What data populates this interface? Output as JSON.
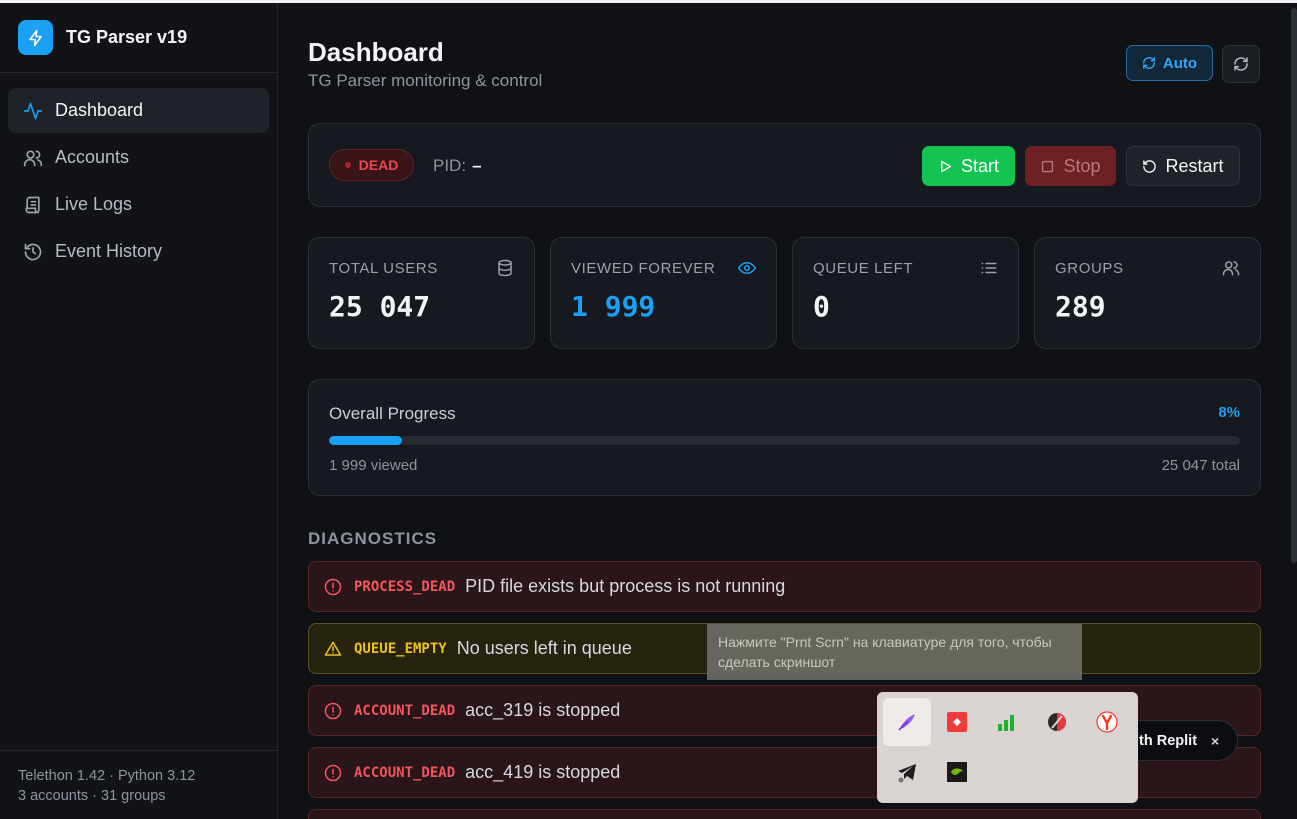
{
  "app": {
    "title": "TG Parser v19"
  },
  "sidebar": {
    "items": [
      {
        "label": "Dashboard",
        "icon": "activity-icon",
        "active": true
      },
      {
        "label": "Accounts",
        "icon": "users-icon"
      },
      {
        "label": "Live Logs",
        "icon": "scroll-icon"
      },
      {
        "label": "Event History",
        "icon": "history-icon"
      }
    ],
    "footer": {
      "line1": "Telethon 1.42 · Python 3.12",
      "line2": "3 accounts · 31 groups"
    }
  },
  "header": {
    "title": "Dashboard",
    "subtitle": "TG Parser monitoring & control",
    "auto_label": "Auto"
  },
  "process": {
    "status": "DEAD",
    "pid_label": "PID:",
    "pid_value": "–",
    "start_label": "Start",
    "stop_label": "Stop",
    "restart_label": "Restart"
  },
  "stats": [
    {
      "label": "TOTAL USERS",
      "value": "25 047",
      "icon": "database-icon"
    },
    {
      "label": "VIEWED FOREVER",
      "value": "1 999",
      "icon": "eye-icon",
      "color": "#1aa0f5"
    },
    {
      "label": "QUEUE LEFT",
      "value": "0",
      "icon": "list-icon"
    },
    {
      "label": "GROUPS",
      "value": "289",
      "icon": "users-icon"
    }
  ],
  "progress": {
    "label": "Overall Progress",
    "percent_text": "8%",
    "fraction": 0.08,
    "viewed_text": "1 999 viewed",
    "total_text": "25 047 total"
  },
  "diagnostics": {
    "title": "DIAGNOSTICS",
    "items": [
      {
        "level": "error",
        "code": "PROCESS_DEAD",
        "message": "PID file exists but process is not running"
      },
      {
        "level": "warning",
        "code": "QUEUE_EMPTY",
        "message": "No users left in queue"
      },
      {
        "level": "error",
        "code": "ACCOUNT_DEAD",
        "message": "acc_319 is stopped"
      },
      {
        "level": "error",
        "code": "ACCOUNT_DEAD",
        "message": "acc_419 is stopped"
      }
    ]
  },
  "overlay": {
    "tooltip": "Нажмите \"Prnt Scrn\" на клавиатуре для того, чтобы сделать скриншот",
    "replit_label": "ith Replit",
    "replit_close": "×"
  },
  "colors": {
    "accent": "#1aa0f5",
    "danger": "#f0474f",
    "success": "#13c451",
    "warning": "#eec21a"
  }
}
